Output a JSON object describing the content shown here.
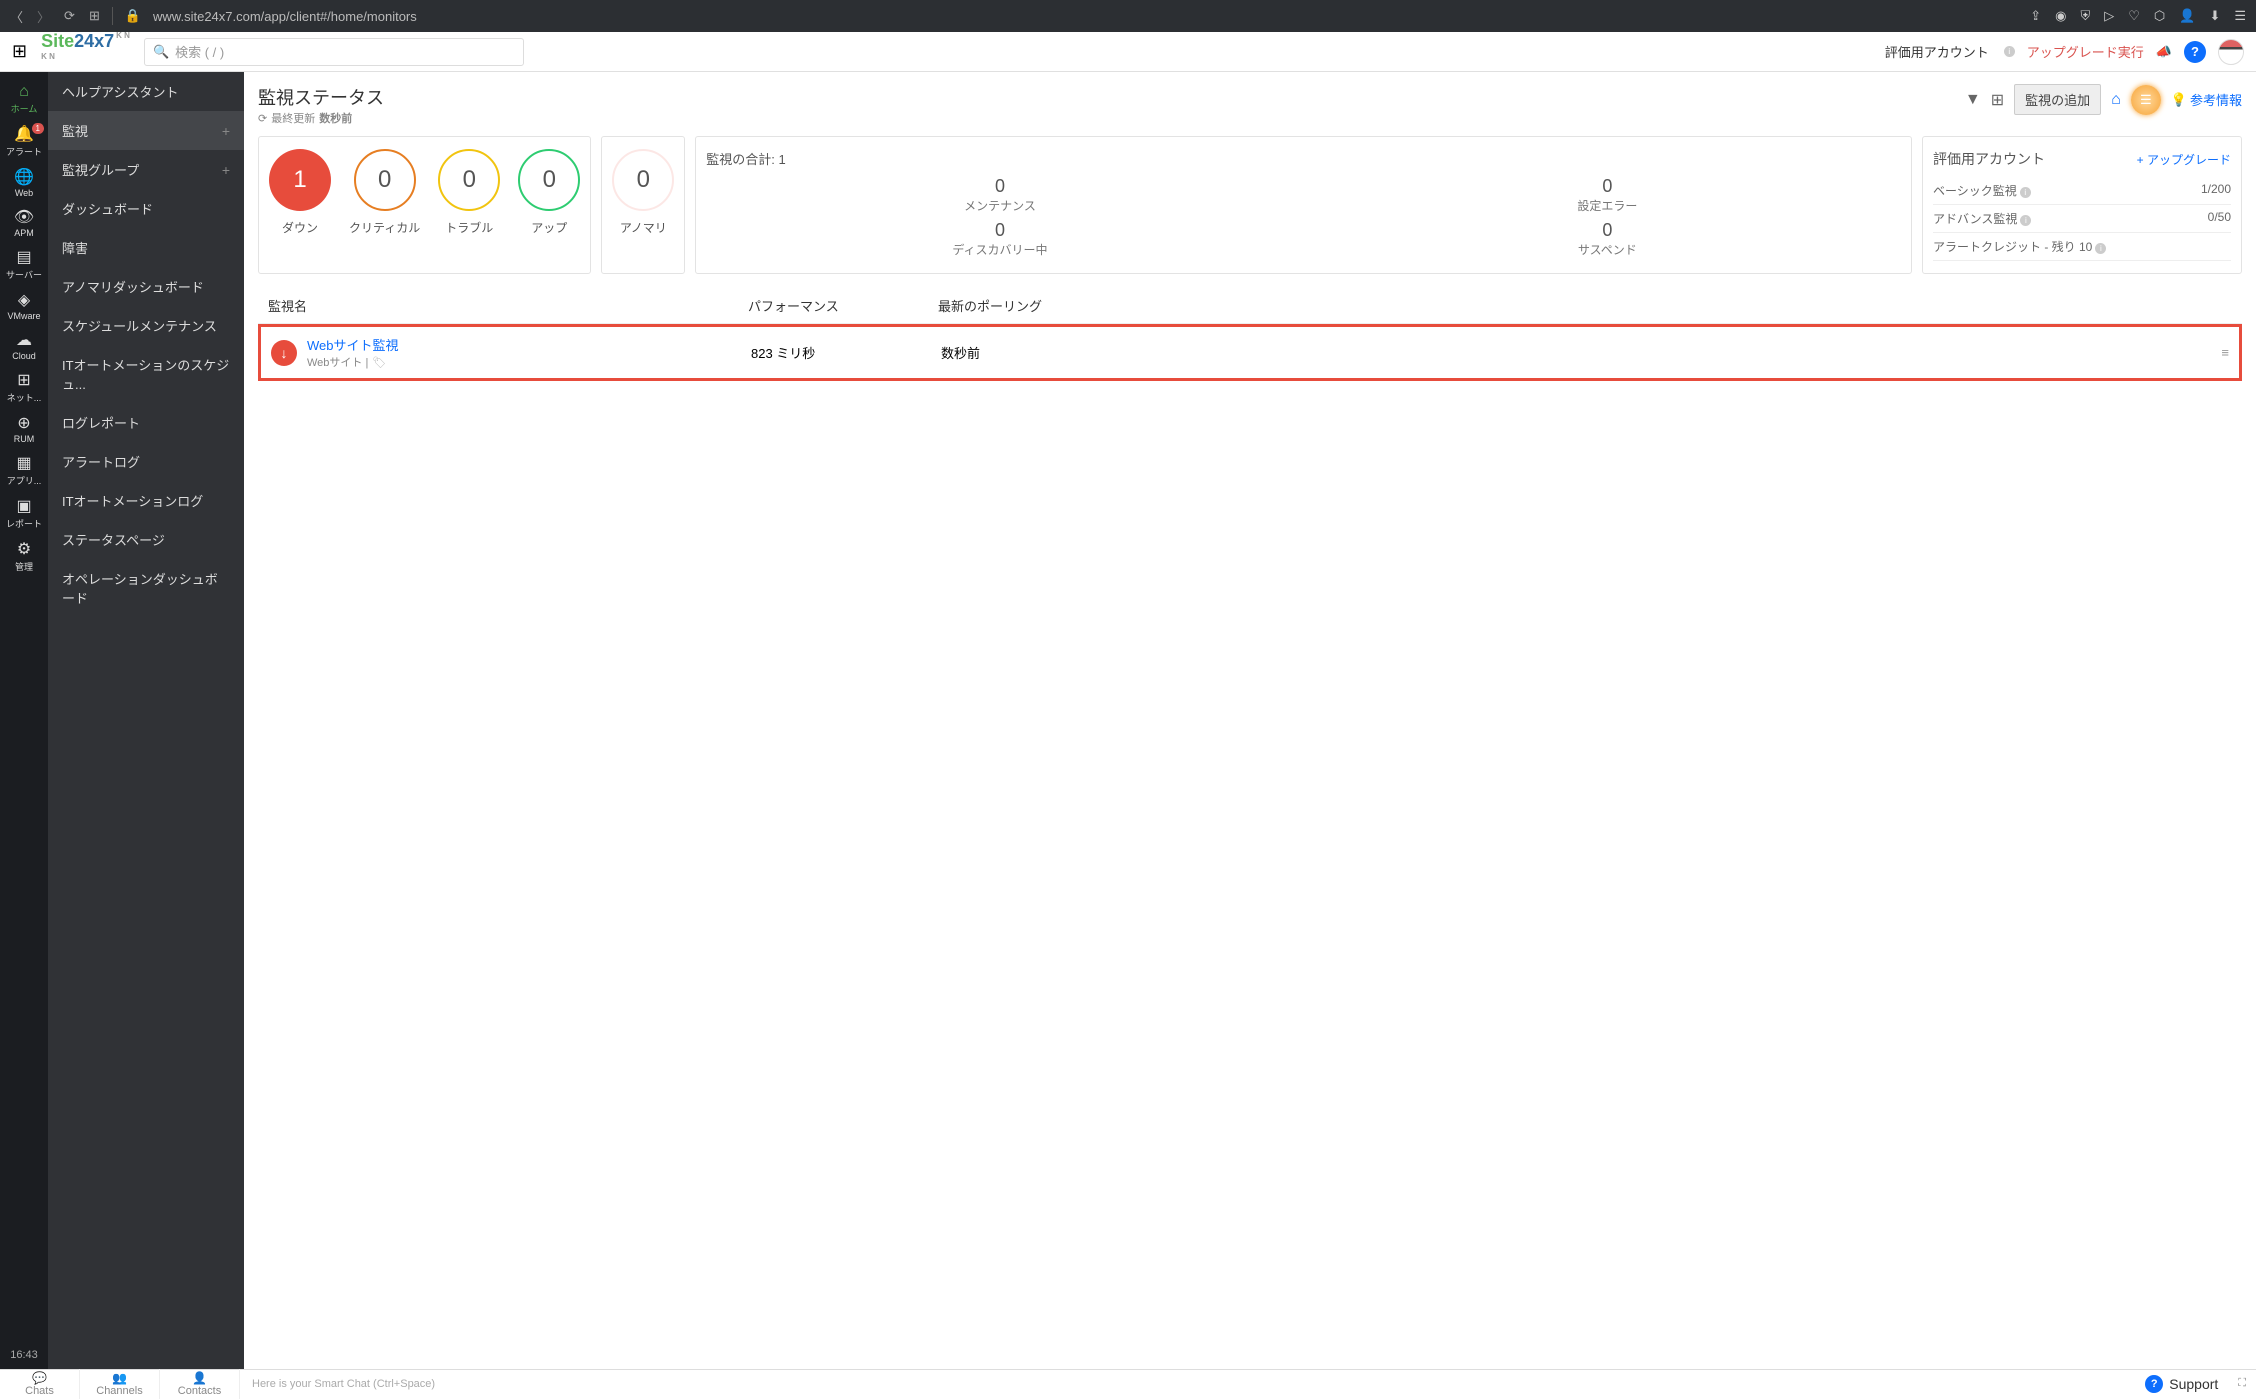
{
  "browser": {
    "url": "www.site24x7.com/app/client#/home/monitors"
  },
  "appbar": {
    "logo_main": "Site",
    "logo_rest": "24x7",
    "search_placeholder": "検索 ( / )",
    "eval_account": "評価用アカウント",
    "upgrade": "アップグレード実行"
  },
  "rail": {
    "items": [
      {
        "icon": "⌂",
        "label": "ホーム"
      },
      {
        "icon": "🔔",
        "label": "アラート",
        "badge": "1"
      },
      {
        "icon": "🌐",
        "label": "Web"
      },
      {
        "icon": "👁",
        "label": "APM"
      },
      {
        "icon": "▤",
        "label": "サーバー"
      },
      {
        "icon": "◈",
        "label": "VMware"
      },
      {
        "icon": "☁",
        "label": "Cloud"
      },
      {
        "icon": "⊞",
        "label": "ネット..."
      },
      {
        "icon": "⊕",
        "label": "RUM"
      },
      {
        "icon": "▦",
        "label": "アプリ..."
      },
      {
        "icon": "▣",
        "label": "レポート"
      },
      {
        "icon": "⚙",
        "label": "管理"
      }
    ],
    "time": "16:43"
  },
  "sidebar": {
    "items": [
      {
        "label": "ヘルプアシスタント"
      },
      {
        "label": "監視",
        "active": true,
        "add": true
      },
      {
        "label": "監視グループ",
        "add": true
      },
      {
        "label": "ダッシュボード"
      },
      {
        "label": "障害"
      },
      {
        "label": "アノマリダッシュボード"
      },
      {
        "label": "スケジュールメンテナンス"
      },
      {
        "label": "ITオートメーションのスケジュ..."
      },
      {
        "label": "ログレポート"
      },
      {
        "label": "アラートログ"
      },
      {
        "label": "ITオートメーションログ"
      },
      {
        "label": "ステータスページ"
      },
      {
        "label": "オペレーションダッシュボード"
      }
    ]
  },
  "page": {
    "title": "監視ステータス",
    "last_update_prefix": "最終更新",
    "last_update_value": "数秒前",
    "add_monitor": "監視の追加",
    "ref_info": "参考情報"
  },
  "statuses": [
    {
      "count": "1",
      "label": "ダウン",
      "cls": "c-down"
    },
    {
      "count": "0",
      "label": "クリティカル",
      "cls": "c-critical"
    },
    {
      "count": "0",
      "label": "トラブル",
      "cls": "c-trouble"
    },
    {
      "count": "0",
      "label": "アップ",
      "cls": "c-up"
    }
  ],
  "anomaly": {
    "count": "0",
    "label": "アノマリ"
  },
  "totals": {
    "title": "監視の合計: 1",
    "cells": [
      {
        "num": "0",
        "label": "メンテナンス"
      },
      {
        "num": "0",
        "label": "設定エラー"
      },
      {
        "num": "0",
        "label": "ディスカバリー中"
      },
      {
        "num": "0",
        "label": "サスペンド"
      }
    ]
  },
  "account": {
    "title": "評価用アカウント",
    "upgrade": "+ アップグレード",
    "rows": [
      {
        "label": "ベーシック監視",
        "value": "1/200"
      },
      {
        "label": "アドバンス監視",
        "value": "0/50"
      },
      {
        "label": "アラートクレジット - 残り 10",
        "value": ""
      }
    ]
  },
  "table": {
    "headers": {
      "name": "監視名",
      "perf": "パフォーマンス",
      "poll": "最新のポーリング"
    },
    "rows": [
      {
        "name": "Webサイト監視",
        "sub": "Webサイト  |",
        "perf": "823 ミリ秒",
        "poll": "数秒前"
      }
    ]
  },
  "bottom": {
    "tabs": [
      {
        "icon": "💬",
        "label": "Chats"
      },
      {
        "icon": "👥",
        "label": "Channels"
      },
      {
        "icon": "👤",
        "label": "Contacts"
      }
    ],
    "smart_chat": "Here is your Smart Chat (Ctrl+Space)",
    "support": "Support"
  }
}
